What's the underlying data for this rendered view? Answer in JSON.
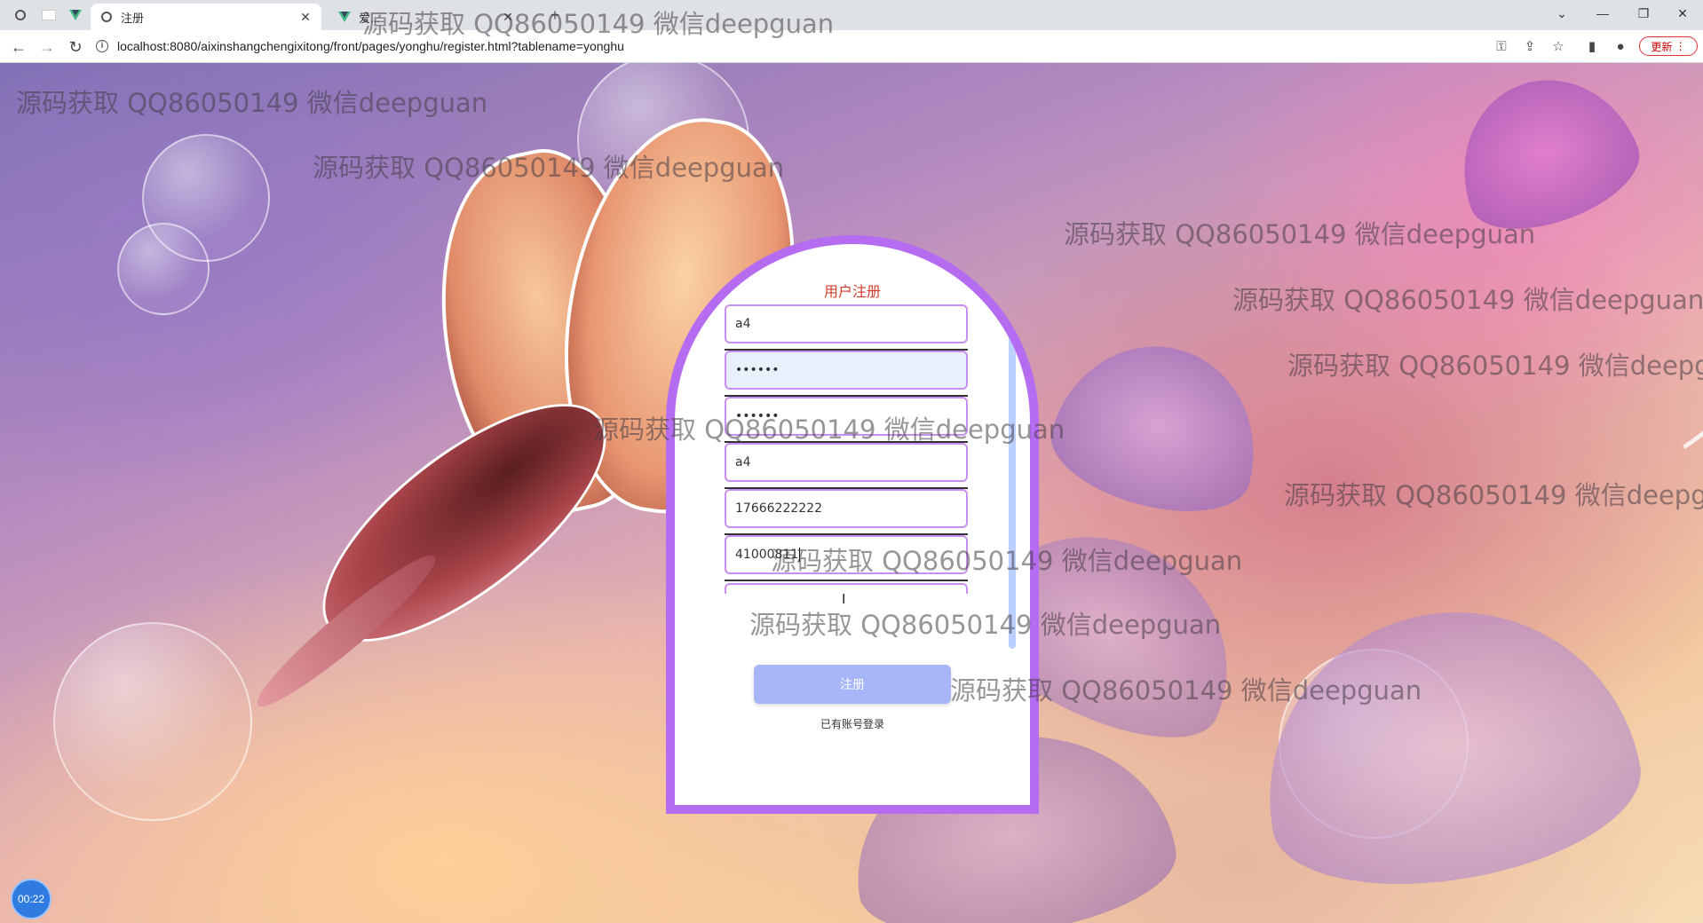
{
  "browser": {
    "tabs": [
      {
        "title": "注册",
        "active": true
      },
      {
        "title": "爱...",
        "active": false
      }
    ],
    "new_tab_icon": "+",
    "url": "localhost:8080/aixinshangchengixitong/front/pages/yonghu/register.html?tablename=yonghu",
    "update_label": "更新"
  },
  "register": {
    "title": "用户注册",
    "fields": {
      "account": "a4",
      "password": "••••••",
      "confirm_password": "••••••",
      "name": "a4",
      "phone": "17666222222",
      "id_number": "41000811"
    },
    "submit_label": "注册",
    "login_link": "已有账号登录"
  },
  "watermark_text": "源码获取 QQ86050149 微信deepguan",
  "recorder": {
    "time": "00:22"
  },
  "colors": {
    "card_border": "#b56cf0",
    "field_border": "#c78ff0",
    "button": "#a6b6f9",
    "title": "#d23b2a"
  }
}
